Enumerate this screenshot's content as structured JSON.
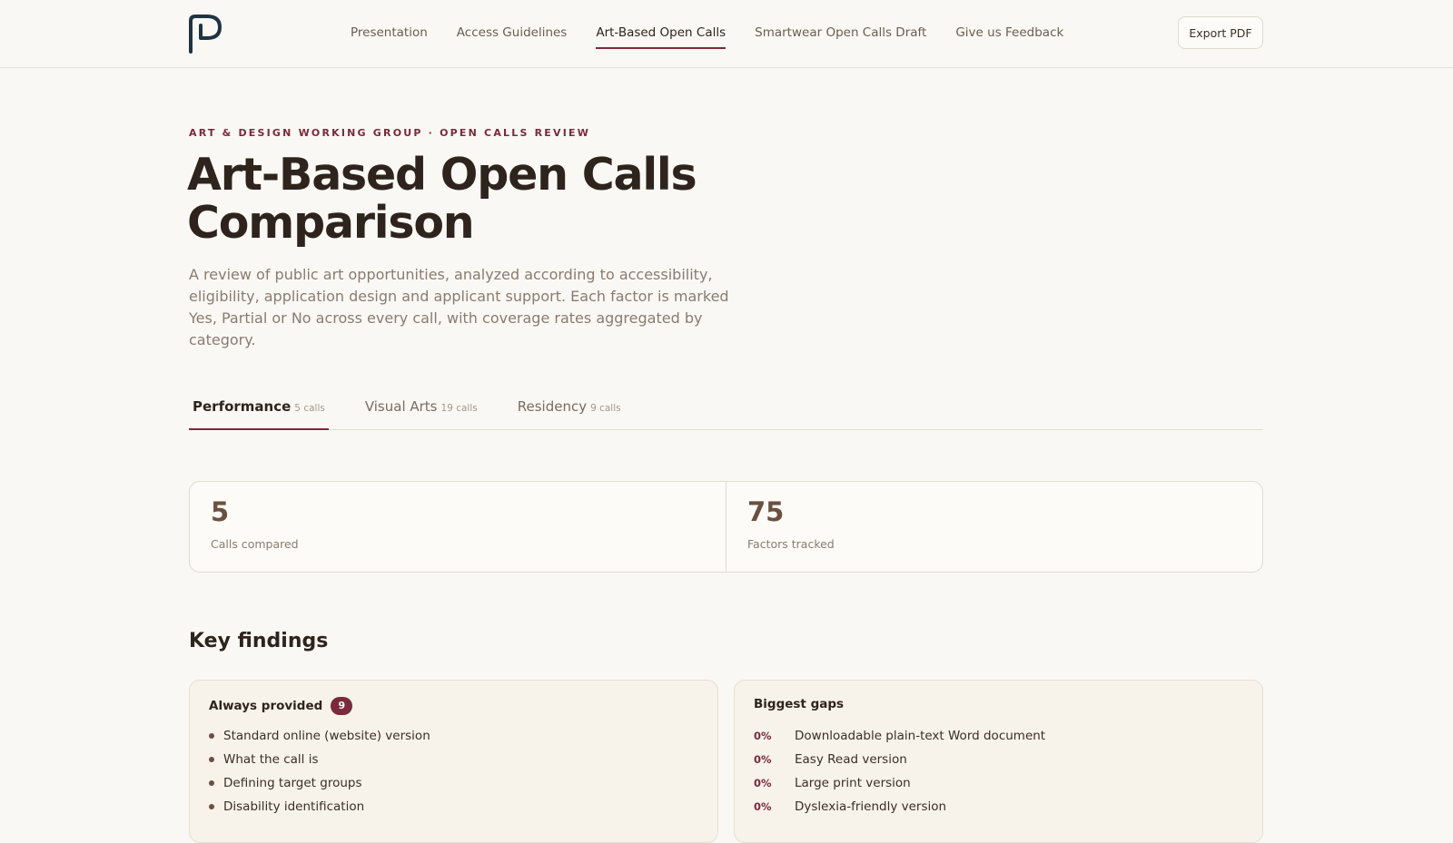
{
  "header": {
    "logo": "P-monogram-logo",
    "nav": [
      {
        "label": "Presentation",
        "active": false
      },
      {
        "label": "Access Guidelines",
        "active": false
      },
      {
        "label": "Art-Based Open Calls",
        "active": true
      },
      {
        "label": "Smartwear Open Calls Draft",
        "active": false
      },
      {
        "label": "Give us Feedback",
        "active": false
      }
    ],
    "export_label": "Export PDF"
  },
  "hero": {
    "eyebrow": "ART & DESIGN WORKING GROUP · OPEN CALLS REVIEW",
    "title_line1": "Art-Based Open Calls",
    "title_line2": "Comparison",
    "lede": "A review of public art opportunities, analyzed according to accessibility, eligibility, application design and applicant support. Each factor is marked Yes, Partial or No across every call, with coverage rates aggregated by category."
  },
  "tabs": [
    {
      "label": "Performance",
      "count": "5 calls",
      "active": true
    },
    {
      "label": "Visual Arts",
      "count": "19 calls",
      "active": false
    },
    {
      "label": "Residency",
      "count": "9 calls",
      "active": false
    }
  ],
  "stats": [
    {
      "value": "5",
      "label": "Calls compared"
    },
    {
      "value": "75",
      "label": "Factors tracked"
    }
  ],
  "findings": {
    "title": "Key findings",
    "always": {
      "title": "Always provided",
      "count": "9",
      "items": [
        "Standard online (website) version",
        "What the call is",
        "Defining target groups",
        "Disability identification"
      ]
    },
    "gaps": {
      "title": "Biggest gaps",
      "items": [
        {
          "pct": "0%",
          "label": "Downloadable plain-text Word document"
        },
        {
          "pct": "0%",
          "label": "Easy Read version"
        },
        {
          "pct": "0%",
          "label": "Large print version"
        },
        {
          "pct": "0%",
          "label": "Dyslexia-friendly version"
        }
      ]
    }
  },
  "colors": {
    "accent": "#7a2a3a",
    "background": "#faf8f4",
    "text": "#2e241d",
    "muted": "#8a7b70",
    "stat_value": "#6b5040",
    "logo": "#1f3442"
  }
}
